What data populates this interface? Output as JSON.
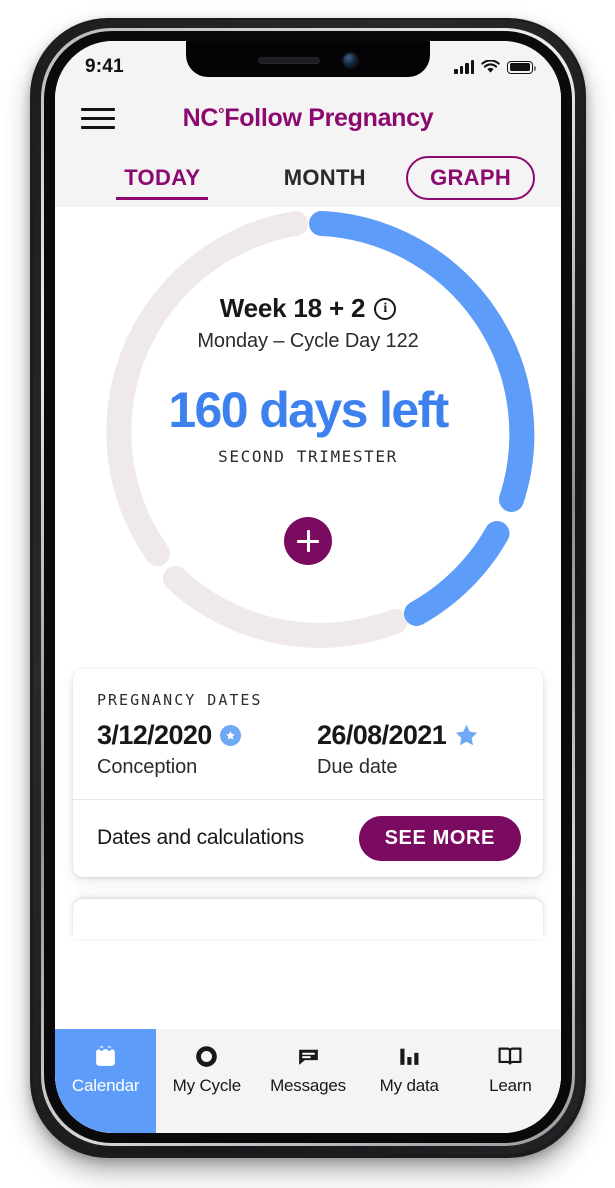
{
  "status_bar": {
    "time": "9:41",
    "signal_icon": "cellular-signal-icon",
    "wifi_icon": "wifi-icon",
    "battery_icon": "battery-full-icon"
  },
  "header": {
    "menu_icon": "hamburger-menu-icon",
    "brand_mark": "NC",
    "brand_degree": "°",
    "brand_rest": "Follow Pregnancy",
    "brand_color": "#8C0A70"
  },
  "tabs": {
    "items": [
      {
        "label": "TODAY",
        "active": true
      },
      {
        "label": "MONTH",
        "active": false
      }
    ],
    "pill": {
      "label": "GRAPH",
      "active": false
    }
  },
  "ring": {
    "progress_color": "#5D9CF8",
    "track_color": "#EFE9E9",
    "week_label": "Week 18 + 2",
    "info_icon": "info-circle-icon",
    "info_glyph": "i",
    "sub_label": "Monday – Cycle Day 122",
    "days_left": "160 days left",
    "days_left_color": "#3D81EF",
    "trimester": "SECOND TRIMESTER",
    "add_button_icon": "plus-icon",
    "add_button_color": "#7B0B60"
  },
  "dates_card": {
    "kicker": "PREGNANCY DATES",
    "entries": [
      {
        "value": "3/12/2020",
        "label": "Conception",
        "icon": "filled-star-badge-icon",
        "icon_style": "badge"
      },
      {
        "value": "26/08/2021",
        "label": "Due date",
        "icon": "star-icon",
        "icon_style": "plain"
      }
    ],
    "footer_text": "Dates and calculations",
    "footer_button": "SEE MORE",
    "footer_button_color": "#7B0B60"
  },
  "bottom_nav": {
    "active_color": "#5D9CF8",
    "items": [
      {
        "label": "Calendar",
        "icon": "calendar-icon",
        "active": true
      },
      {
        "label": "My Cycle",
        "icon": "circle-ring-icon",
        "active": false
      },
      {
        "label": "Messages",
        "icon": "message-bubble-icon",
        "active": false
      },
      {
        "label": "My data",
        "icon": "bar-chart-icon",
        "active": false
      },
      {
        "label": "Learn",
        "icon": "open-book-icon",
        "active": false
      }
    ]
  }
}
